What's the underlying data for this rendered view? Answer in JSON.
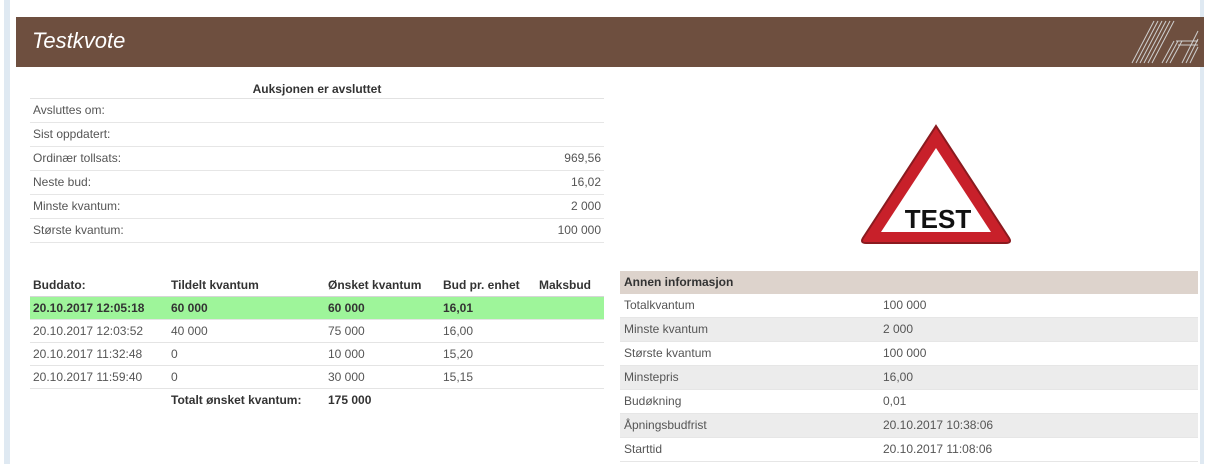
{
  "header": {
    "title": "Testkvote"
  },
  "auction": {
    "status": "Auksjonen er avsluttet",
    "rows": [
      {
        "label": "Avsluttes om:",
        "value": ""
      },
      {
        "label": "Sist oppdatert:",
        "value": ""
      },
      {
        "label": "Ordinær tollsats:",
        "value": "969,56"
      },
      {
        "label": "Neste bud:",
        "value": "16,02"
      },
      {
        "label": "Minste kvantum:",
        "value": "2 000"
      },
      {
        "label": "Største kvantum:",
        "value": "100 000"
      }
    ]
  },
  "warning": {
    "text": "TEST"
  },
  "bids": {
    "headers": [
      "Buddato:",
      "Tildelt kvantum",
      "Ønsket kvantum",
      "Bud pr. enhet",
      "Maksbud"
    ],
    "rows": [
      [
        "20.10.2017 12:05:18",
        "60 000",
        "60 000",
        "16,01",
        ""
      ],
      [
        "20.10.2017 12:03:52",
        "40 000",
        "75 000",
        "16,00",
        ""
      ],
      [
        "20.10.2017 11:32:48",
        "0",
        "10 000",
        "15,20",
        ""
      ],
      [
        "20.10.2017 11:59:40",
        "0",
        "30 000",
        "15,15",
        ""
      ]
    ],
    "total_label": "Totalt ønsket kvantum:",
    "total_value": "175 000"
  },
  "annen": {
    "title": "Annen informasjon",
    "rows": [
      {
        "label": "Totalkvantum",
        "value": "100 000"
      },
      {
        "label": "Minste kvantum",
        "value": "2 000"
      },
      {
        "label": "Største kvantum",
        "value": "100 000"
      },
      {
        "label": "Minstepris",
        "value": "16,00"
      },
      {
        "label": "Budøkning",
        "value": "0,01"
      },
      {
        "label": "Åpningsbudfrist",
        "value": "20.10.2017 10:38:06"
      },
      {
        "label": "Starttid",
        "value": "20.10.2017 11:08:06"
      }
    ]
  },
  "colors": {
    "header_bg": "#6e4f3f",
    "winning_row": "#9ef59a",
    "annen_header": "#ddd3cc",
    "warning_red": "#c8202a"
  }
}
